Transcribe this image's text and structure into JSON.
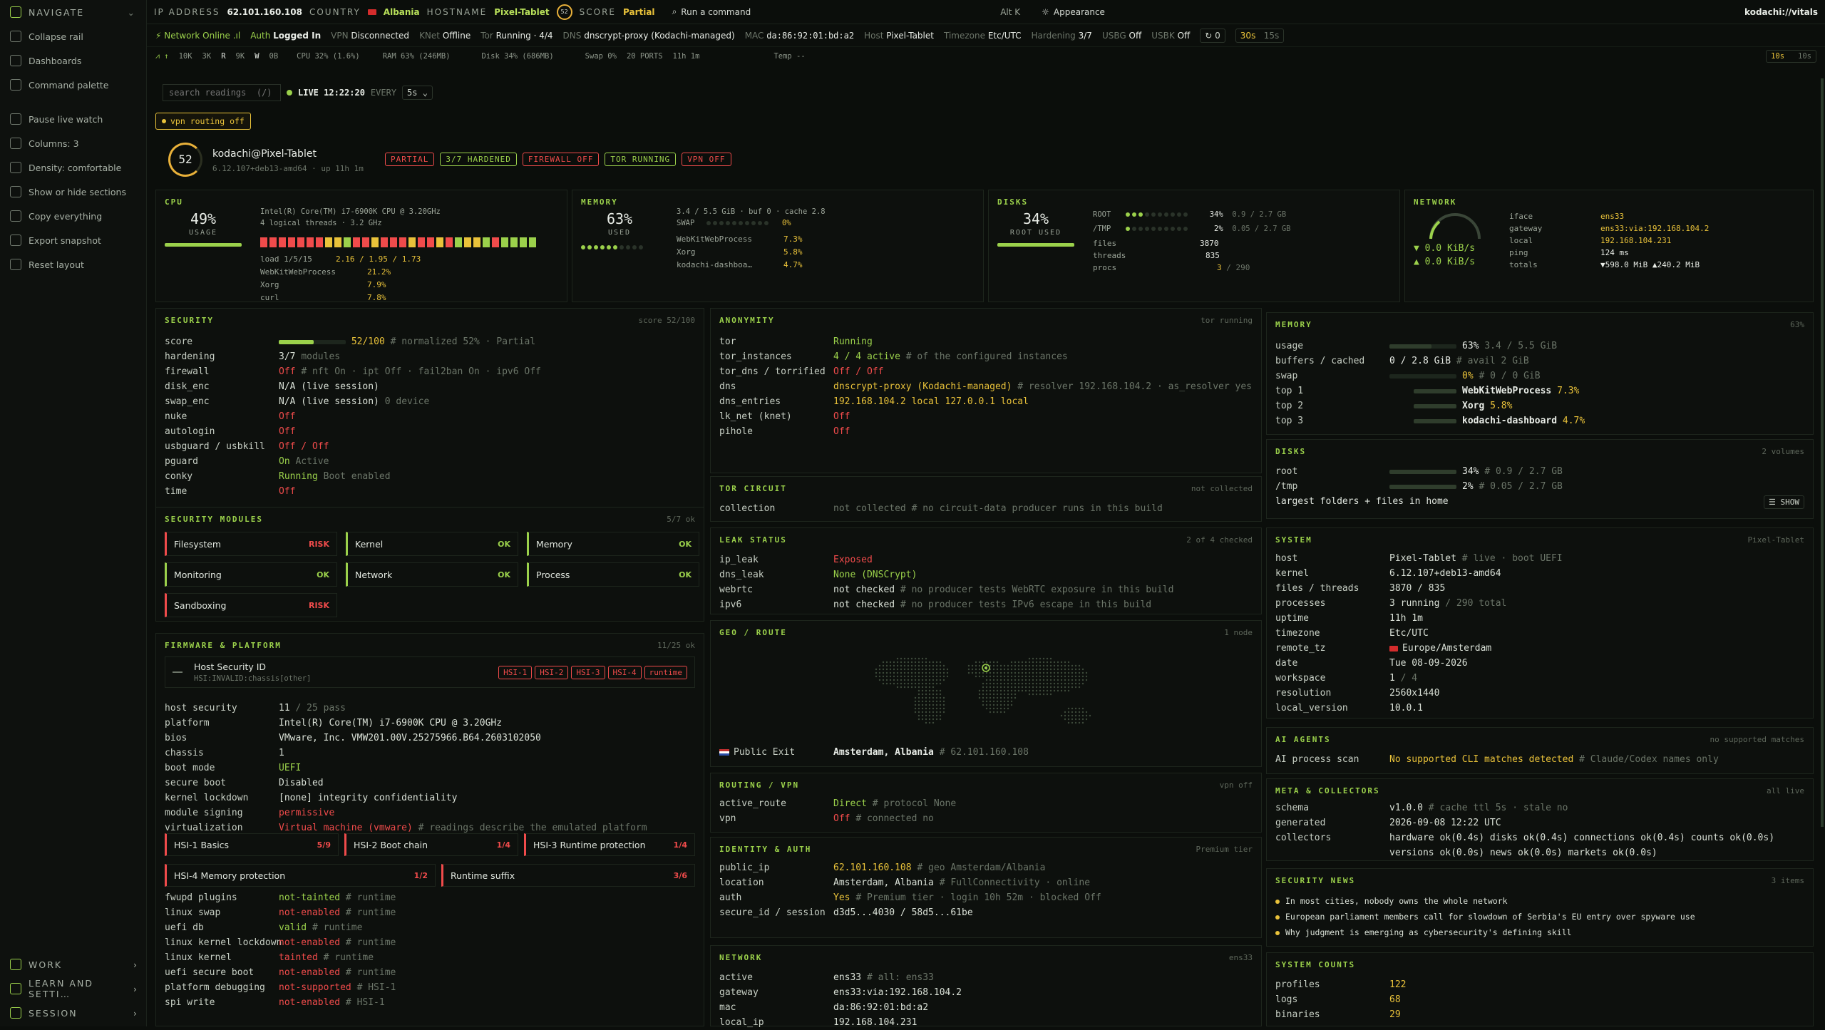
{
  "sidebar": {
    "nav_header": "NAVIGATE",
    "items": [
      {
        "label": "Collapse rail",
        "icon": "collapse-icon"
      },
      {
        "label": "Dashboards",
        "icon": "dashboard-icon"
      },
      {
        "label": "Command palette",
        "icon": "search-icon"
      },
      {
        "label": "Pause live watch",
        "icon": "pause-icon"
      },
      {
        "label": "Columns: 3",
        "icon": "columns-icon"
      },
      {
        "label": "Density: comfortable",
        "icon": "density-icon"
      },
      {
        "label": "Show or hide sections",
        "icon": "eye-icon"
      },
      {
        "label": "Copy everything",
        "icon": "copy-icon"
      },
      {
        "label": "Export snapshot",
        "icon": "export-icon"
      },
      {
        "label": "Reset layout",
        "icon": "reset-icon"
      }
    ],
    "bottom": [
      {
        "label": "WORK"
      },
      {
        "label": "LEARN AND SETTI…"
      },
      {
        "label": "SESSION"
      }
    ]
  },
  "topbar": {
    "ip_label": "IP ADDRESS",
    "ip": "62.101.160.108",
    "country_label": "COUNTRY",
    "country": "Albania",
    "hostname_label": "HOSTNAME",
    "hostname": "Pixel-Tablet",
    "score_ring": "52",
    "score_label": "SCORE",
    "score": "Partial",
    "command": "Run a command",
    "shortcut": "Alt K",
    "appearance": "Appearance",
    "brand": "kodachi://vitals"
  },
  "statusbar": {
    "network": "Network Online",
    "auth_label": "Auth",
    "auth": "Logged In",
    "vpn_label": "VPN",
    "vpn": "Disconnected",
    "ksnet_label": "KNet",
    "ksnet": "Offline",
    "tor_label": "Tor",
    "tor": "Running · 4/4",
    "dns_label": "DNS",
    "dns": "dnscrypt-proxy (Kodachi-managed)",
    "mac_label": "MAC",
    "mac": "da:86:92:01:bd:a2",
    "host_label": "Host",
    "host": "Pixel-Tablet",
    "tz_label": "Timezone",
    "tz": "Etc/UTC",
    "hardening_label": "Hardening",
    "hardening": "3/7",
    "usbg_label": "USBG",
    "usbg": "Off",
    "usbk_label": "USBK",
    "usbk": "Off",
    "count": "0",
    "refresh1": "30s",
    "refresh2": "15s"
  },
  "metricbar": {
    "m1": "10K",
    "m2": "3K",
    "m3": "R",
    "m4": "9K",
    "m5": "W",
    "m6": "0B",
    "cpu": "CPU 32% (1.6%)",
    "ram": "RAM 63% (246MB)",
    "disk": "Disk 34% (686MB)",
    "swap": "Swap 0%",
    "ports": "20 PORTS",
    "uptime": "11h 1m",
    "temp": "Temp --",
    "r1": "10s",
    "r2": "10s"
  },
  "toolbar": {
    "search_placeholder": "search readings  (/)",
    "live": "LIVE 12:22:20",
    "every": "EVERY",
    "interval": "5s"
  },
  "vpn_banner": "vpn routing off",
  "identity": {
    "score": "52",
    "user": "kodachi@Pixel-Tablet",
    "kernel": "6.12.107+deb13-amd64 · up 11h 1m",
    "badges": [
      "PARTIAL",
      "3/7 HARDENED",
      "FIREWALL OFF",
      "TOR RUNNING",
      "VPN OFF"
    ]
  },
  "cpu_card": {
    "title": "CPU",
    "pct": "49%",
    "sub": "USAGE",
    "model": "Intel(R) Core(TM) i7-6900K CPU @ 3.20GHz",
    "threads": "4 logical threads · 3.2 GHz",
    "load_label": "load 1/5/15",
    "load": "2.16 / 1.95 / 1.73",
    "procs": [
      [
        "WebKitWebProcess",
        "21.2%"
      ],
      [
        "Xorg",
        "7.9%"
      ],
      [
        "curl",
        "7.8%"
      ]
    ]
  },
  "mem_card": {
    "title": "MEMORY",
    "pct": "63%",
    "sub": "USED",
    "line": "3.4 / 5.5 GiB · buf 0 · cache 2.8",
    "swap_label": "SWAP",
    "swap": "0%",
    "procs": [
      [
        "WebKitWebProcess",
        "7.3%"
      ],
      [
        "Xorg",
        "5.8%"
      ],
      [
        "kodachi-dashboa…",
        "4.7%"
      ]
    ]
  },
  "disk_card": {
    "title": "DISKS",
    "pct": "34%",
    "sub": "ROOT USED",
    "rows": [
      [
        "ROOT",
        "34%",
        "0.9 / 2.7 GB"
      ],
      [
        "/TMP",
        "2%",
        "0.05 / 2.7 GB"
      ]
    ],
    "files_label": "files",
    "files": "3870",
    "threads_label": "threads",
    "threads": "835",
    "procs_label": "procs",
    "procs": "3",
    "procs_total": "/ 290"
  },
  "net_card": {
    "title": "NETWORK",
    "down": "▼ 0.0 KiB/s",
    "up": "▲ 0.0 KiB/s",
    "rows": [
      [
        "iface",
        "ens33"
      ],
      [
        "gateway",
        "ens33:via:192.168.104.2"
      ],
      [
        "local",
        "192.168.104.231"
      ],
      [
        "ping",
        "124 ms"
      ],
      [
        "totals",
        "▼598.0 MiB ▲240.2 MiB"
      ]
    ]
  },
  "security": {
    "title": "SECURITY",
    "right": "score 52/100",
    "score_label": "score",
    "score": "52/100",
    "score_cmt": "# normalized 52% · Partial",
    "rows": [
      [
        "hardening",
        "3/7",
        "modules",
        ""
      ],
      [
        "firewall",
        "Off",
        "# nft On · ipt Off · fail2ban On · ipv6 Off",
        "red"
      ],
      [
        "disk_enc",
        "N/A (live session)",
        "",
        ""
      ],
      [
        "swap_enc",
        "N/A (live session)",
        "0 device",
        ""
      ],
      [
        "nuke",
        "Off",
        "",
        "red"
      ],
      [
        "autologin",
        "Off",
        "",
        "red"
      ],
      [
        "usbguard / usbkill",
        "Off / Off",
        "",
        "red"
      ],
      [
        "pguard",
        "On",
        "Active",
        "green"
      ],
      [
        "conky",
        "Running",
        "Boot enabled",
        "green"
      ],
      [
        "time",
        "Off",
        "",
        "red"
      ]
    ]
  },
  "modules": {
    "title": "SECURITY MODULES",
    "right": "5/7 ok",
    "items": [
      {
        "name": "Filesystem",
        "status": "RISK"
      },
      {
        "name": "Kernel",
        "status": "OK"
      },
      {
        "name": "Memory",
        "status": "OK"
      },
      {
        "name": "Monitoring",
        "status": "OK"
      },
      {
        "name": "Network",
        "status": "OK"
      },
      {
        "name": "Process",
        "status": "OK"
      },
      {
        "name": "Sandboxing",
        "status": "RISK"
      }
    ]
  },
  "firmware": {
    "title": "FIRMWARE & PLATFORM",
    "right": "11/25 ok",
    "hsi_title": "Host Security ID",
    "hsi_sub": "HSI:INVALID:chassis[other]",
    "hsi_badges": [
      "HSI-1",
      "HSI-2",
      "HSI-3",
      "HSI-4",
      "runtime"
    ],
    "rows": [
      [
        "host security",
        "11",
        "/ 25 pass",
        ""
      ],
      [
        "platform",
        "Intel(R) Core(TM) i7-6900K CPU @ 3.20GHz",
        "",
        ""
      ],
      [
        "bios",
        "VMware, Inc. VMW201.00V.25275966.B64.2603102050",
        "",
        ""
      ],
      [
        "chassis",
        "1",
        "",
        ""
      ],
      [
        "boot mode",
        "UEFI",
        "",
        "green"
      ],
      [
        "secure boot",
        "Disabled",
        "",
        ""
      ],
      [
        "kernel lockdown",
        "[none] integrity confidentiality",
        "",
        ""
      ],
      [
        "module signing",
        "permissive",
        "",
        "red"
      ],
      [
        "virtualization",
        "Virtual machine (vmware)",
        "# readings describe the emulated platform",
        "red"
      ]
    ],
    "hsi_cards": [
      {
        "name": "HSI-1 Basics",
        "score": "5/9"
      },
      {
        "name": "HSI-2 Boot chain",
        "score": "1/4"
      },
      {
        "name": "HSI-3 Runtime protection",
        "score": "1/4"
      },
      {
        "name": "HSI-4 Memory protection",
        "score": "1/2"
      },
      {
        "name": "Runtime suffix",
        "score": "3/6"
      }
    ],
    "rows2": [
      [
        "fwupd plugins",
        "not-tainted",
        "# runtime",
        "green"
      ],
      [
        "linux swap",
        "not-enabled",
        "# runtime",
        "red"
      ],
      [
        "uefi db",
        "valid",
        "# runtime",
        "green"
      ],
      [
        "linux kernel lockdown",
        "not-enabled",
        "# runtime",
        "red"
      ],
      [
        "linux kernel",
        "tainted",
        "# runtime",
        "red"
      ],
      [
        "uefi secure boot",
        "not-enabled",
        "# runtime",
        "red"
      ],
      [
        "platform debugging",
        "not-supported",
        "# HSI-1",
        "red"
      ],
      [
        "spi write",
        "not-enabled",
        "# HSI-1",
        "red"
      ]
    ]
  },
  "anonymity": {
    "title": "ANONYMITY",
    "right": "tor running",
    "rows": [
      [
        "tor",
        "Running",
        "",
        "green"
      ],
      [
        "tor_instances",
        "4 / 4 active",
        "# of the configured instances",
        "green"
      ],
      [
        "tor_dns / torrified",
        "Off / Off",
        "",
        "red"
      ],
      [
        "dns",
        "dnscrypt-proxy (Kodachi-managed)",
        "# resolver 192.168.104.2 · as_resolver yes",
        "yellow"
      ],
      [
        "dns_entries",
        "192.168.104.2 local  127.0.0.1 local",
        "",
        "yellow"
      ],
      [
        "lk_net (knet)",
        "Off",
        "",
        "red"
      ],
      [
        "pihole",
        "Off",
        "",
        "red"
      ]
    ]
  },
  "torcircuit": {
    "title": "TOR CIRCUIT",
    "right": "not collected",
    "key": "collection",
    "val": "not collected # no circuit-data producer runs in this build"
  },
  "leak": {
    "title": "LEAK STATUS",
    "right": "2 of 4 checked",
    "rows": [
      [
        "ip_leak",
        "Exposed",
        "",
        "red"
      ],
      [
        "dns_leak",
        "None (DNSCrypt)",
        "",
        "green"
      ],
      [
        "webrtc",
        "not checked",
        "# no producer tests WebRTC exposure in this build",
        ""
      ],
      [
        "ipv6",
        "not checked",
        "# no producer tests IPv6 escape in this build",
        ""
      ]
    ]
  },
  "geo": {
    "title": "GEO / ROUTE",
    "right": "1 node",
    "exit_label": "Public Exit",
    "exit": "Amsterdam, Albania",
    "exit_ip": "# 62.101.160.108"
  },
  "routing": {
    "title": "ROUTING / VPN",
    "right": "vpn off",
    "rows": [
      [
        "active_route",
        "Direct",
        "# protocol None",
        "green"
      ],
      [
        "vpn",
        "Off",
        "# connected no",
        "red"
      ]
    ]
  },
  "identity_auth": {
    "title": "IDENTITY & AUTH",
    "right": "Premium tier",
    "rows": [
      [
        "public_ip",
        "62.101.160.108",
        "# geo Amsterdam/Albania",
        "yellow"
      ],
      [
        "location",
        "Amsterdam, Albania",
        "# FullConnectivity · online",
        ""
      ],
      [
        "auth",
        "Yes",
        "# Premium tier · login 10h 52m · blocked Off",
        "yellow"
      ],
      [
        "secure_id / session",
        "d3d5...4030 / 58d5...61be",
        "",
        ""
      ]
    ]
  },
  "network_panel": {
    "title": "NETWORK",
    "right": "ens33",
    "rows": [
      [
        "active",
        "ens33",
        "# all: ens33",
        ""
      ],
      [
        "gateway",
        "ens33:via:192.168.104.2",
        "",
        ""
      ],
      [
        "mac",
        "da:86:92:01:bd:a2",
        "",
        ""
      ],
      [
        "local_ip",
        "192.168.104.231",
        "",
        ""
      ]
    ]
  },
  "memory_panel": {
    "title": "MEMORY",
    "right": "63%",
    "rows": [
      [
        "usage",
        "63%",
        "3.4 / 5.5 GiB"
      ],
      [
        "buffers / cached",
        "0 / 2.8 GiB",
        "# avail 2 GiB"
      ],
      [
        "swap",
        "0%",
        "# 0 / 0 GiB"
      ],
      [
        "top 1",
        "WebKitWebProcess",
        "7.3%"
      ],
      [
        "top 2",
        "Xorg",
        "5.8%"
      ],
      [
        "top 3",
        "kodachi-dashboard",
        "4.7%"
      ]
    ]
  },
  "disks_panel": {
    "title": "DISKS",
    "right": "2 volumes",
    "rows": [
      [
        "root",
        "34%",
        "# 0.9 / 2.7 GB"
      ],
      [
        "/tmp",
        "2%",
        "# 0.05 / 2.7 GB"
      ]
    ],
    "largest": "largest folders + files in home",
    "show": "SHOW"
  },
  "system_panel": {
    "title": "SYSTEM",
    "right": "Pixel-Tablet",
    "rows": [
      [
        "host",
        "Pixel-Tablet",
        "# live · boot UEFI"
      ],
      [
        "kernel",
        "6.12.107+deb13-amd64",
        ""
      ],
      [
        "files / threads",
        "3870 / 835",
        ""
      ],
      [
        "processes",
        "3 running",
        "/ 290 total"
      ],
      [
        "uptime",
        "11h 1m",
        ""
      ],
      [
        "timezone",
        "Etc/UTC",
        ""
      ],
      [
        "remote_tz",
        "Europe/Amsterdam",
        ""
      ],
      [
        "date",
        "Tue 08-09-2026",
        ""
      ],
      [
        "workspace",
        "1",
        "/ 4"
      ],
      [
        "resolution",
        "2560x1440",
        ""
      ],
      [
        "local_version",
        "10.0.1",
        ""
      ]
    ]
  },
  "ai_panel": {
    "title": "AI AGENTS",
    "right": "no supported matches",
    "key": "AI process scan",
    "val": "No supported CLI matches detected",
    "cmt": "# Claude/Codex names only"
  },
  "meta_panel": {
    "title": "META & COLLECTORS",
    "right": "all live",
    "schema": "v1.0.0",
    "schema_cmt": "# cache ttl 5s · stale no",
    "generated": "2026-09-08 12:22 UTC",
    "collectors1": "hardware ok(0.4s) disks ok(0.4s) connections ok(0.4s) counts ok(0.0s)",
    "collectors2": "versions ok(0.0s) news ok(0.0s) markets ok(0.0s)",
    "k_schema": "schema",
    "k_generated": "generated",
    "k_collectors": "collectors"
  },
  "news_panel": {
    "title": "SECURITY NEWS",
    "right": "3 items",
    "items": [
      "In most cities, nobody owns the whole network",
      "European parliament members call for slowdown of Serbia's EU entry over spyware use",
      "Why judgment is emerging as cybersecurity's defining skill"
    ]
  },
  "counts_panel": {
    "title": "SYSTEM COUNTS",
    "rows": [
      [
        "profiles",
        "122"
      ],
      [
        "logs",
        "68"
      ],
      [
        "binaries",
        "29"
      ]
    ]
  },
  "colors": {
    "accent": "#9bd14b",
    "warn": "#e9c23a",
    "danger": "#f04b4b",
    "bg": "#0b0e0b"
  }
}
